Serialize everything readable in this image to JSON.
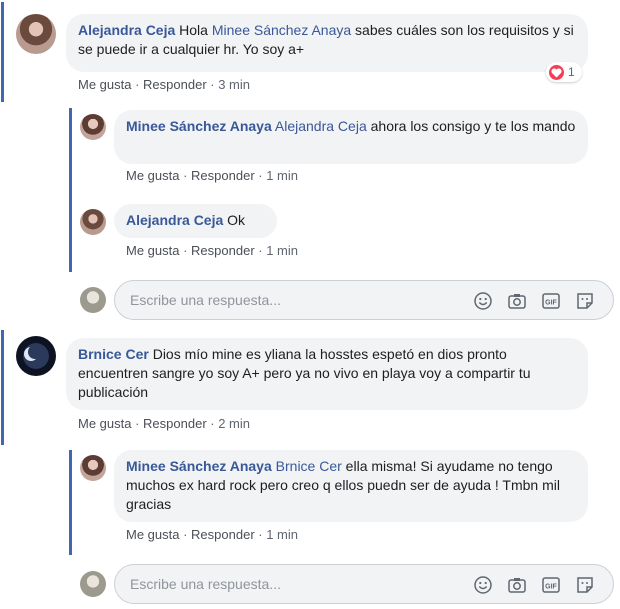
{
  "comments": [
    {
      "author": "Alejandra Ceja",
      "mention": "Minee Sánchez Anaya",
      "text": " sabes cuáles son los requisitos y si se puede ir a cualquier hr. Yo soy a+",
      "prefix": " Hola ",
      "like": "Me gusta",
      "reply": "Responder",
      "time": "3 min",
      "reaction_count": "1",
      "replies": [
        {
          "author": "Minee Sánchez Anaya",
          "mention": "Alejandra Ceja",
          "text": " ahora los consigo y te los mando",
          "like": "Me gusta",
          "reply": "Responder",
          "time": "1 min"
        },
        {
          "author": "Alejandra Ceja",
          "text": " Ok",
          "like": "Me gusta",
          "reply": "Responder",
          "time": "1 min"
        }
      ]
    },
    {
      "author": "Brnice Cer",
      "text": " Dios mío mine es yliana la hosstes espetó en dios pronto encuentren sangre yo soy A+ pero ya no vivo en playa voy a compartir tu publicación",
      "like": "Me gusta",
      "reply": "Responder",
      "time": "2 min",
      "replies": [
        {
          "author": "Minee Sánchez Anaya",
          "mention": "Brnice Cer",
          "text": " ella misma! Si ayudame no tengo muchos ex hard rock pero creo q ellos puedn ser de ayuda ! Tmbn mil gracias",
          "like": "Me gusta",
          "reply": "Responder",
          "time": "1 min"
        }
      ]
    }
  ],
  "reply_box": {
    "placeholder": "Escribe una respuesta..."
  },
  "separator": " · ",
  "icons": [
    "emoji-icon",
    "camera-icon",
    "gif-icon",
    "sticker-icon"
  ],
  "colors": {
    "name": "#385898",
    "thread_line": "#4267b2",
    "bubble": "#f2f3f5",
    "heart": "#f33e58"
  }
}
